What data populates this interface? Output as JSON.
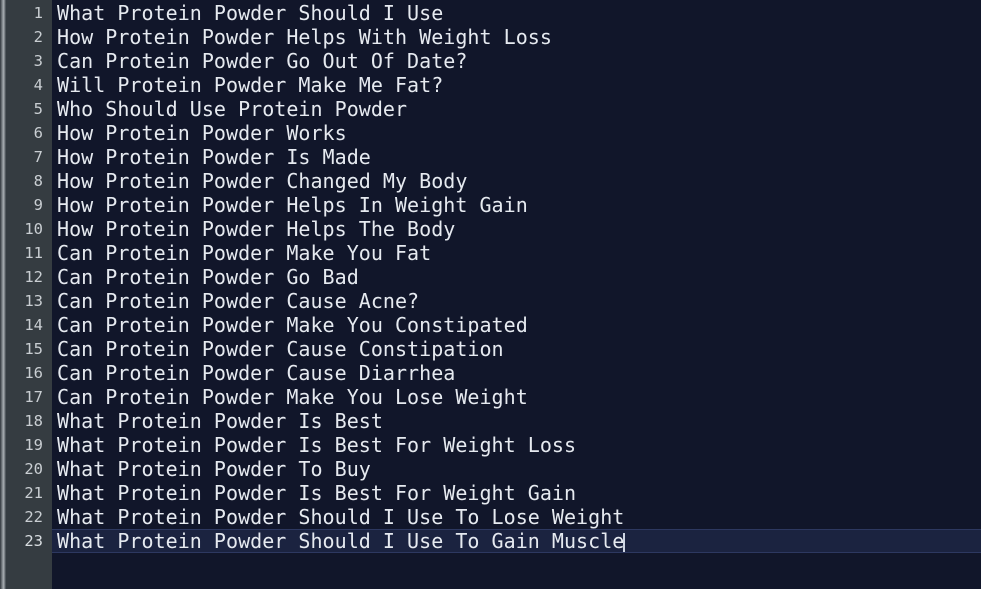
{
  "app": {
    "type": "code-editor",
    "theme_colors": {
      "editor_background": "#11162a",
      "gutter_background": "#353c41",
      "line_number_color": "#c9ced2",
      "text_color": "#e6eaf0",
      "active_line_background": "#1b2340",
      "active_line_border": "#2d3860",
      "caret_color": "#cfd6e4",
      "left_edge_strip": "#a9aeb2"
    }
  },
  "editor": {
    "active_line_number": 23,
    "caret_column": 48,
    "total_lines": 23,
    "lines": [
      {
        "number": "1",
        "text": "What Protein Powder Should I Use"
      },
      {
        "number": "2",
        "text": "How Protein Powder Helps With Weight Loss"
      },
      {
        "number": "3",
        "text": "Can Protein Powder Go Out Of Date?"
      },
      {
        "number": "4",
        "text": "Will Protein Powder Make Me Fat?"
      },
      {
        "number": "5",
        "text": "Who Should Use Protein Powder"
      },
      {
        "number": "6",
        "text": "How Protein Powder Works"
      },
      {
        "number": "7",
        "text": "How Protein Powder Is Made"
      },
      {
        "number": "8",
        "text": "How Protein Powder Changed My Body"
      },
      {
        "number": "9",
        "text": "How Protein Powder Helps In Weight Gain"
      },
      {
        "number": "10",
        "text": "How Protein Powder Helps The Body"
      },
      {
        "number": "11",
        "text": "Can Protein Powder Make You Fat"
      },
      {
        "number": "12",
        "text": "Can Protein Powder Go Bad"
      },
      {
        "number": "13",
        "text": "Can Protein Powder Cause Acne?"
      },
      {
        "number": "14",
        "text": "Can Protein Powder Make You Constipated"
      },
      {
        "number": "15",
        "text": "Can Protein Powder Cause Constipation"
      },
      {
        "number": "16",
        "text": "Can Protein Powder Cause Diarrhea"
      },
      {
        "number": "17",
        "text": "Can Protein Powder Make You Lose Weight"
      },
      {
        "number": "18",
        "text": "What Protein Powder Is Best"
      },
      {
        "number": "19",
        "text": "What Protein Powder Is Best For Weight Loss"
      },
      {
        "number": "20",
        "text": "What Protein Powder To Buy"
      },
      {
        "number": "21",
        "text": "What Protein Powder Is Best For Weight Gain"
      },
      {
        "number": "22",
        "text": "What Protein Powder Should I Use To Lose Weight"
      },
      {
        "number": "23",
        "text": "What Protein Powder Should I Use To Gain Muscle"
      }
    ]
  }
}
